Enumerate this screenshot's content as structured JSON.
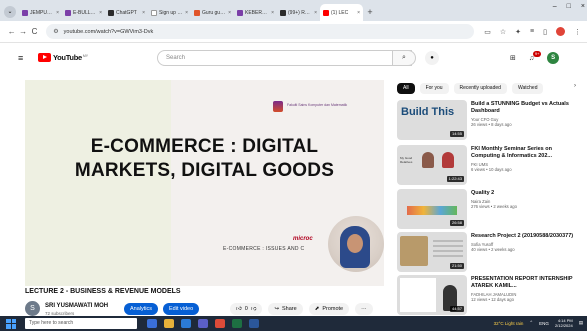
{
  "browser": {
    "tabs": [
      {
        "label": "JEMPUTAN",
        "favicon_color": "#7b3fa8",
        "active": false
      },
      {
        "label": "E-BULLETIN",
        "favicon_color": "#7b3fa8",
        "active": false
      },
      {
        "label": "ChatGPT",
        "favicon_color": "#2b2b2b",
        "active": false
      },
      {
        "label": "Sign up | Su",
        "favicon_color": "#ffffff",
        "active": false
      },
      {
        "label": "Guru guna T",
        "favicon_color": "#e0542a",
        "active": false
      },
      {
        "label": "KEBERKESA",
        "favicon_color": "#7b3fa8",
        "active": false
      },
      {
        "label": "(99+) Respo",
        "favicon_color": "#2b2b2b",
        "active": false
      },
      {
        "label": "(1) LEC",
        "favicon_color": "#ff0000",
        "active": true
      }
    ],
    "tab_close": "×",
    "new_tab": "+",
    "tab_menu": "⌄",
    "window_buttons": {
      "minimize": "–",
      "maximize": "□",
      "close": "×"
    },
    "url": "youtube.com/watch?v=GWVim3-Dvk",
    "nav": {
      "back": "←",
      "forward": "→",
      "reload": "C"
    }
  },
  "youtube": {
    "logo_text": "YouTube",
    "logo_country": "MY",
    "search_placeholder": "Search",
    "notification_count": "9+",
    "account_initial": "S"
  },
  "video": {
    "slide_title_line1": "E-COMMERCE : DIGITAL",
    "slide_title_line2": "MARKETS, DIGITAL GOODS",
    "slide_faculty": "Fakulti Sains Komputer dan Matematik",
    "slide_microcap": "microc",
    "slide_footer": "E-COMMERCE : ISSUES AND C",
    "title": "LECTURE 2 - BUSINESS & REVENUE MODELS",
    "channel_name": "SRI YUSMAWATI MOH",
    "channel_subs": "72 subscribers",
    "channel_initial": "S",
    "buttons": {
      "analytics": "Analytics",
      "edit": "Edit video"
    },
    "actions": {
      "like_count": "0",
      "share": "Share",
      "promote": "Promote",
      "more": "···"
    }
  },
  "sidebar": {
    "chips": [
      "All",
      "For you",
      "Recently uploaded",
      "Watched"
    ],
    "chip_next": "›",
    "items": [
      {
        "title": "Build a STUNNING Budget vs Actuals Dashboard",
        "channel": "Your CFO Guy",
        "meta": "26 views • 8 days ago",
        "duration": "14:55",
        "thumb_text": "Build This"
      },
      {
        "title": "FKI Monthly Seminar Series on Computing & Informatics 202...",
        "channel": "FKI UMS",
        "meta": "6 views • 10 days ago",
        "duration": "1:22:43",
        "thumb_text": "My Good Relatives"
      },
      {
        "title": "Quality 2",
        "channel": "Naira Zain",
        "meta": "276 views • 2 weeks ago",
        "duration": "26:58",
        "thumb_text": ""
      },
      {
        "title": "Research Project 2 (20190588/2030377)",
        "channel": "Sofia Yusoff",
        "meta": "40 views • 2 weeks ago",
        "duration": "21:50",
        "thumb_text": ""
      },
      {
        "title": "PRESENTATION REPORT INTERNSHIP ATAREK KAMIL...",
        "channel": "FADHILAH JAMALUDIN",
        "meta": "12 views • 12 days ago",
        "duration": "44:57",
        "thumb_text": ""
      }
    ]
  },
  "taskbar": {
    "search_placeholder": "Type here to search",
    "weather": "32°C Light rain",
    "language": "ENG",
    "time": "4:14 PM",
    "date": "2/12/2024"
  },
  "colors": {
    "yt_red": "#ff0000",
    "blue_button": "#065fd4",
    "taskbar": "#1f2a3a"
  }
}
